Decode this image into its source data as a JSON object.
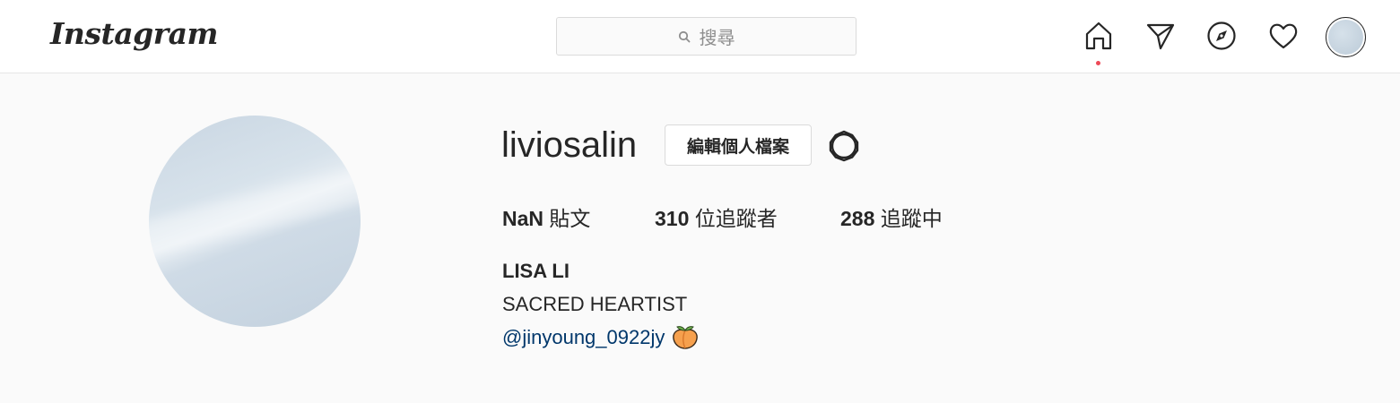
{
  "header": {
    "logo_text": "Instagram",
    "search": {
      "placeholder": "搜尋",
      "icon": "search-icon"
    },
    "nav_icons": [
      "home-icon",
      "direct-send-icon",
      "explore-compass-icon",
      "activity-heart-icon",
      "profile-avatar"
    ],
    "notification_dot_color": "#ed4956"
  },
  "profile": {
    "username": "liviosalin",
    "edit_button_label": "編輯個人檔案",
    "settings_icon": "gear-icon",
    "stats": {
      "posts_count": "NaN",
      "posts_label": "貼文",
      "followers_count": "310",
      "followers_label": "位追蹤者",
      "following_count": "288",
      "following_label": "追蹤中"
    },
    "full_name": "LISA LI",
    "bio_line": "SACRED HEARTIST",
    "bio_mention": "@jinyoung_0922jy",
    "bio_emoji_icon": "peach-icon"
  },
  "colors": {
    "link": "#00376b",
    "text": "#262626",
    "background": "#fafafa"
  }
}
